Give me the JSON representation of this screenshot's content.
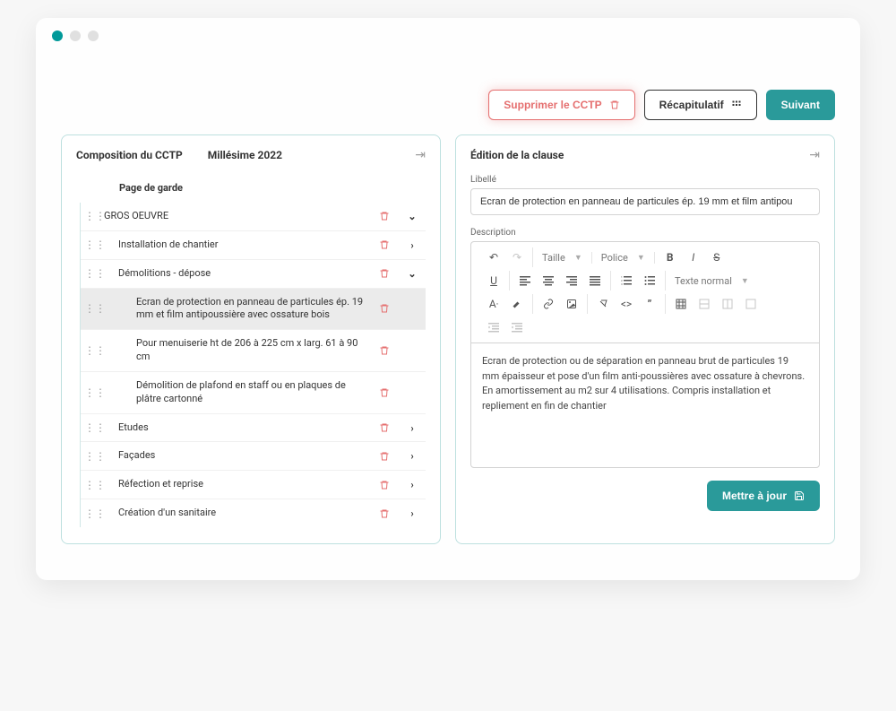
{
  "toolbar": {
    "delete": "Supprimer le CCTP",
    "recap": "Récapitulatif",
    "next": "Suivant"
  },
  "leftPanel": {
    "title": "Composition du CCTP",
    "vintage": "Millésime 2022",
    "pageDeGarde": "Page de garde",
    "items": {
      "grosOeuvre": "GROS OEUVRE",
      "installation": "Installation de chantier",
      "demolitions": "Démolitions - dépose",
      "ecran": "Ecran de protection en panneau de particules ép. 19 mm et film antipoussière avec ossature bois",
      "menuiserie": "Pour menuiserie ht de 206 à 225 cm x larg. 61 à 90 cm",
      "plafond": "Démolition de plafond en staff ou en plaques de plâtre cartonné",
      "etudes": "Etudes",
      "facades": "Façades",
      "refection": "Réfection et reprise",
      "sanitaire": "Création d'un sanitaire"
    }
  },
  "rightPanel": {
    "title": "Édition de la clause",
    "libelleLabel": "Libellé",
    "libelleValue": "Ecran de protection en panneau de particules ép. 19 mm et film antipou",
    "descriptionLabel": "Description",
    "toolbar": {
      "taille": "Taille",
      "police": "Police",
      "texteNormal": "Texte normal"
    },
    "descriptionValue": "Ecran de protection ou de séparation en panneau brut de particules 19 mm épaisseur et pose d'un film anti-poussières avec ossature à chevrons. En amortissement au m2 sur 4 utilisations. Compris installation et repliement en fin de chantier",
    "updateButton": "Mettre à jour"
  }
}
